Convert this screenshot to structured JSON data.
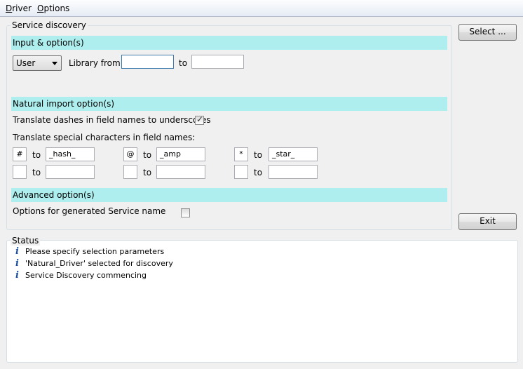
{
  "menu": {
    "driver": "Driver",
    "options": "Options"
  },
  "service_discovery": {
    "title": "Service discovery",
    "input_section": {
      "title": "Input & option(s)",
      "type_select_value": "User",
      "library_from_label": "Library from",
      "library_from_value": "",
      "to_label": "to",
      "library_to_value": ""
    },
    "natural_section": {
      "title": "Natural import option(s)",
      "translate_dashes_label": "Translate dashes in field names to underscores",
      "translate_dashes_checked": true,
      "translate_special_label": "Translate special characters in field names:",
      "to_label": "to",
      "mappings": [
        {
          "char": "#",
          "replacement": "_hash_"
        },
        {
          "char": "@",
          "replacement": "_amp"
        },
        {
          "char": "*",
          "replacement": "_star_"
        },
        {
          "char": "",
          "replacement": ""
        },
        {
          "char": "",
          "replacement": ""
        },
        {
          "char": "",
          "replacement": ""
        }
      ]
    },
    "advanced_section": {
      "title": "Advanced option(s)",
      "service_name_label": "Options for generated Service name",
      "service_name_checked": false
    }
  },
  "buttons": {
    "select": "Select ...",
    "exit": "Exit"
  },
  "status": {
    "title": "Status",
    "messages": [
      "Please specify selection parameters",
      "'Natural_Driver' selected for discovery",
      "Service Discovery commencing"
    ]
  }
}
